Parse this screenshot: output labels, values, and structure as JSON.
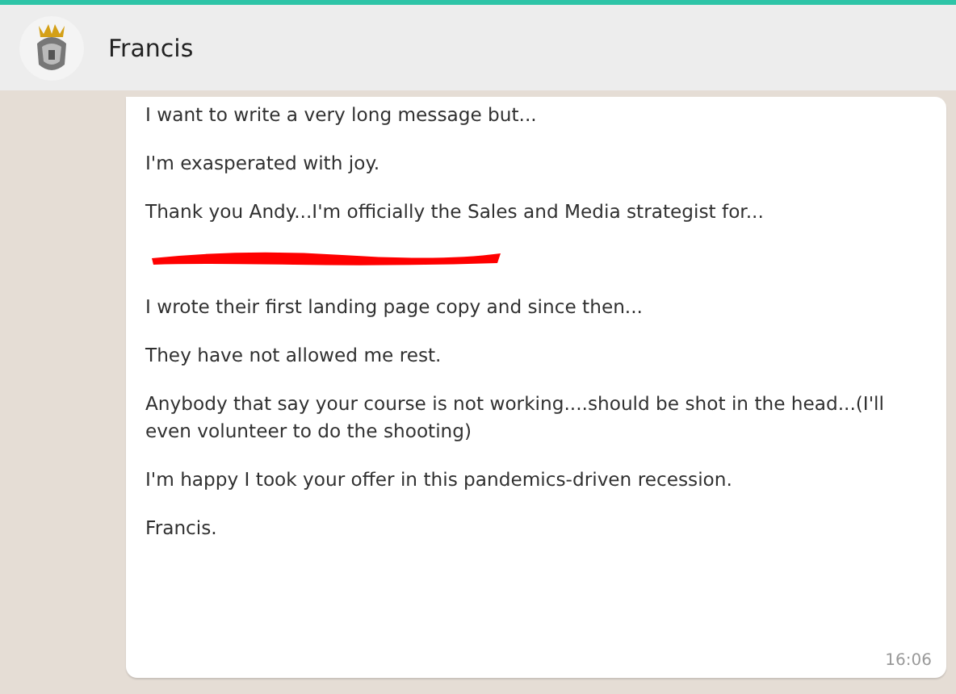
{
  "header": {
    "contact_name": "Francis"
  },
  "message": {
    "paragraphs": [
      {
        "kind": "text",
        "text": "I want to write a very long message but..."
      },
      {
        "kind": "text",
        "text": "I'm exasperated with joy."
      },
      {
        "kind": "text",
        "text": "Thank you Andy...I'm officially the Sales and Media strategist for..."
      },
      {
        "kind": "redacted"
      },
      {
        "kind": "text",
        "text": "I wrote their first landing page copy and since then..."
      },
      {
        "kind": "text",
        "text": "They have not allowed me rest."
      },
      {
        "kind": "text",
        "text": "Anybody that say your course is not working....should be shot in the head...(I'll even volunteer to do the shooting)"
      },
      {
        "kind": "text",
        "text": "I'm happy I took your offer in this pandemics-driven recession."
      },
      {
        "kind": "text",
        "text": "Francis."
      }
    ],
    "time": "16:06"
  }
}
